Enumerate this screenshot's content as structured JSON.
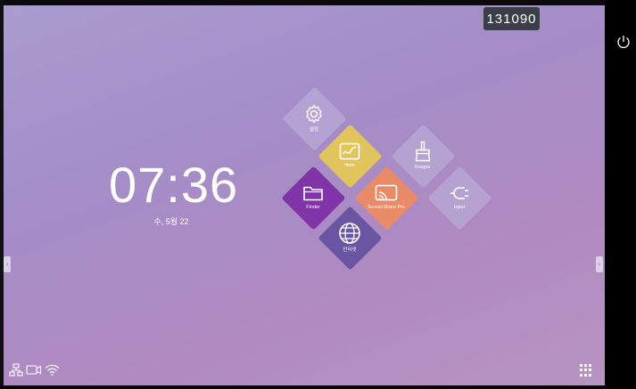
{
  "badge": {
    "text": "131090"
  },
  "clock": {
    "time": "07:36",
    "date": "수, 5월 22"
  },
  "apps": [
    {
      "label": "설정",
      "icon": "gear-icon",
      "color": "#b3a9d4"
    },
    {
      "label": "Note",
      "icon": "note-icon",
      "color": "#e2c45c"
    },
    {
      "label": "Keeper",
      "icon": "broom-icon",
      "color": "#b3a9d4"
    },
    {
      "label": "Finder",
      "icon": "folder-icon",
      "color": "#8034a8"
    },
    {
      "label": "ScreenShare Pro",
      "icon": "screenshare-icon",
      "color": "#e98b66"
    },
    {
      "label": "Input",
      "icon": "plug-icon",
      "color": "#b3a9d4"
    },
    {
      "label": "인터넷",
      "icon": "globe-icon",
      "color": "#6a55a3"
    }
  ]
}
